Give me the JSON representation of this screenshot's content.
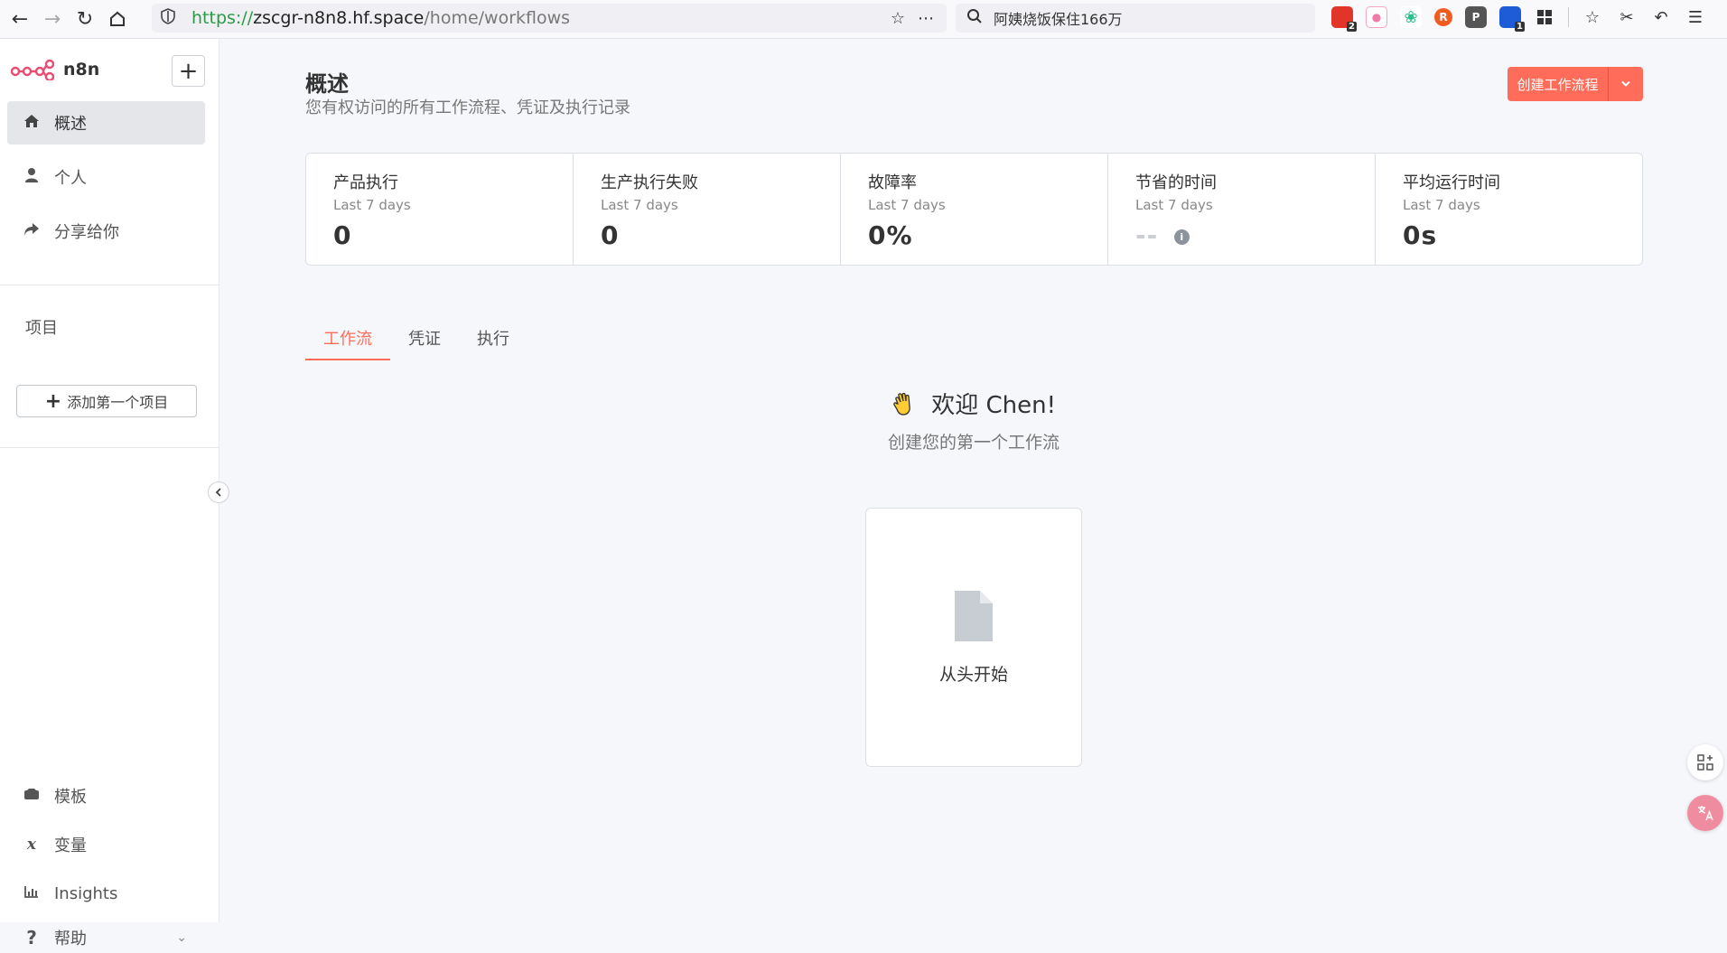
{
  "browser": {
    "url_scheme": "https://",
    "url_host": "zscgr-n8n8.hf.space",
    "url_path": "/home/workflows",
    "search_text": "阿姨烧饭保住166万",
    "ext_badges": [
      "2",
      "1"
    ]
  },
  "sidebar": {
    "brand": "n8n",
    "nav": [
      {
        "label": "概述",
        "icon": "home-icon"
      },
      {
        "label": "个人",
        "icon": "user-icon"
      },
      {
        "label": "分享给你",
        "icon": "share-icon"
      }
    ],
    "projects_label": "项目",
    "add_project": "添加第一个项目",
    "bottom": [
      {
        "label": "模板",
        "icon": "templates-icon"
      },
      {
        "label": "变量",
        "icon": "variables-icon"
      },
      {
        "label": "Insights",
        "icon": "insights-icon"
      },
      {
        "label": "帮助",
        "icon": "help-icon"
      }
    ]
  },
  "header": {
    "title": "概述",
    "subtitle": "您有权访问的所有工作流程、凭证及执行记录",
    "create_button": "创建工作流程"
  },
  "stats": [
    {
      "label": "产品执行",
      "period": "Last 7 days",
      "value": "0"
    },
    {
      "label": "生产执行失败",
      "period": "Last 7 days",
      "value": "0"
    },
    {
      "label": "故障率",
      "period": "Last 7 days",
      "value": "0%"
    },
    {
      "label": "节省的时间",
      "period": "Last 7 days",
      "value": "--"
    },
    {
      "label": "平均运行时间",
      "period": "Last 7 days",
      "value": "0s"
    }
  ],
  "tabs": [
    "工作流",
    "凭证",
    "执行"
  ],
  "welcome": {
    "title": "欢迎 Chen!",
    "subtitle": "创建您的第一个工作流",
    "start_card": "从头开始"
  },
  "colors": {
    "accent": "#ff6d5a",
    "sidebar_active": "#e4e6ea"
  }
}
